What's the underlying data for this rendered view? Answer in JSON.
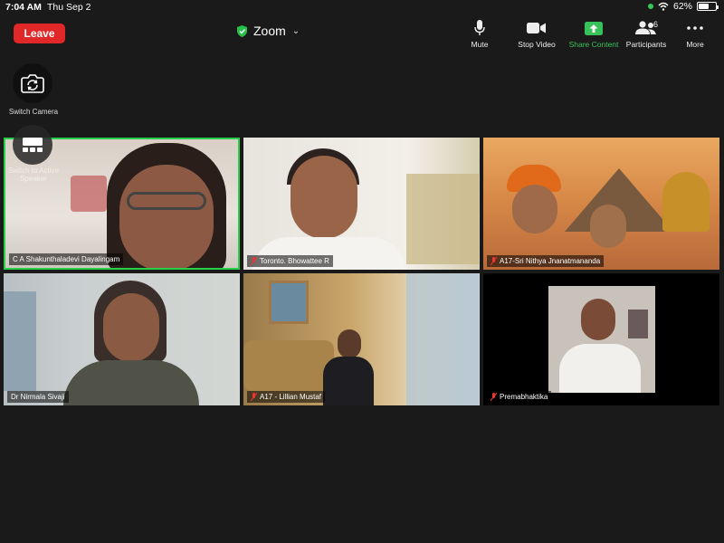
{
  "status_bar": {
    "time": "7:04 AM",
    "date": "Thu Sep 2",
    "battery": "62%",
    "battery_level": 0.62
  },
  "toolbar": {
    "leave_label": "Leave",
    "title": "Zoom",
    "mute_label": "Mute",
    "stop_video_label": "Stop Video",
    "share_label": "Share Content",
    "participants_label": "Participants",
    "participants_count": "6",
    "more_label": "More"
  },
  "controls": {
    "switch_camera_label": "Switch Camera",
    "switch_speaker_label": "Switch to Active Speaker"
  },
  "participants": [
    {
      "name": "C A Shakunthaladevi Dayalingam",
      "muted": false,
      "active": true
    },
    {
      "name": "Toronto. Bhowattee R",
      "muted": true,
      "active": false
    },
    {
      "name": "A17-Sri Nithya Jnanatmananda",
      "muted": true,
      "active": false
    },
    {
      "name": "Dr Nirmala Sivaji",
      "muted": false,
      "active": false
    },
    {
      "name": "A17 - Lillian Mustaf",
      "muted": true,
      "active": false
    },
    {
      "name": "Premabhaktika",
      "muted": true,
      "active": false
    }
  ],
  "colors": {
    "leave": "#e02828",
    "share": "#36c15a",
    "active_border": "#27d04a",
    "background": "#1a1a1a"
  }
}
